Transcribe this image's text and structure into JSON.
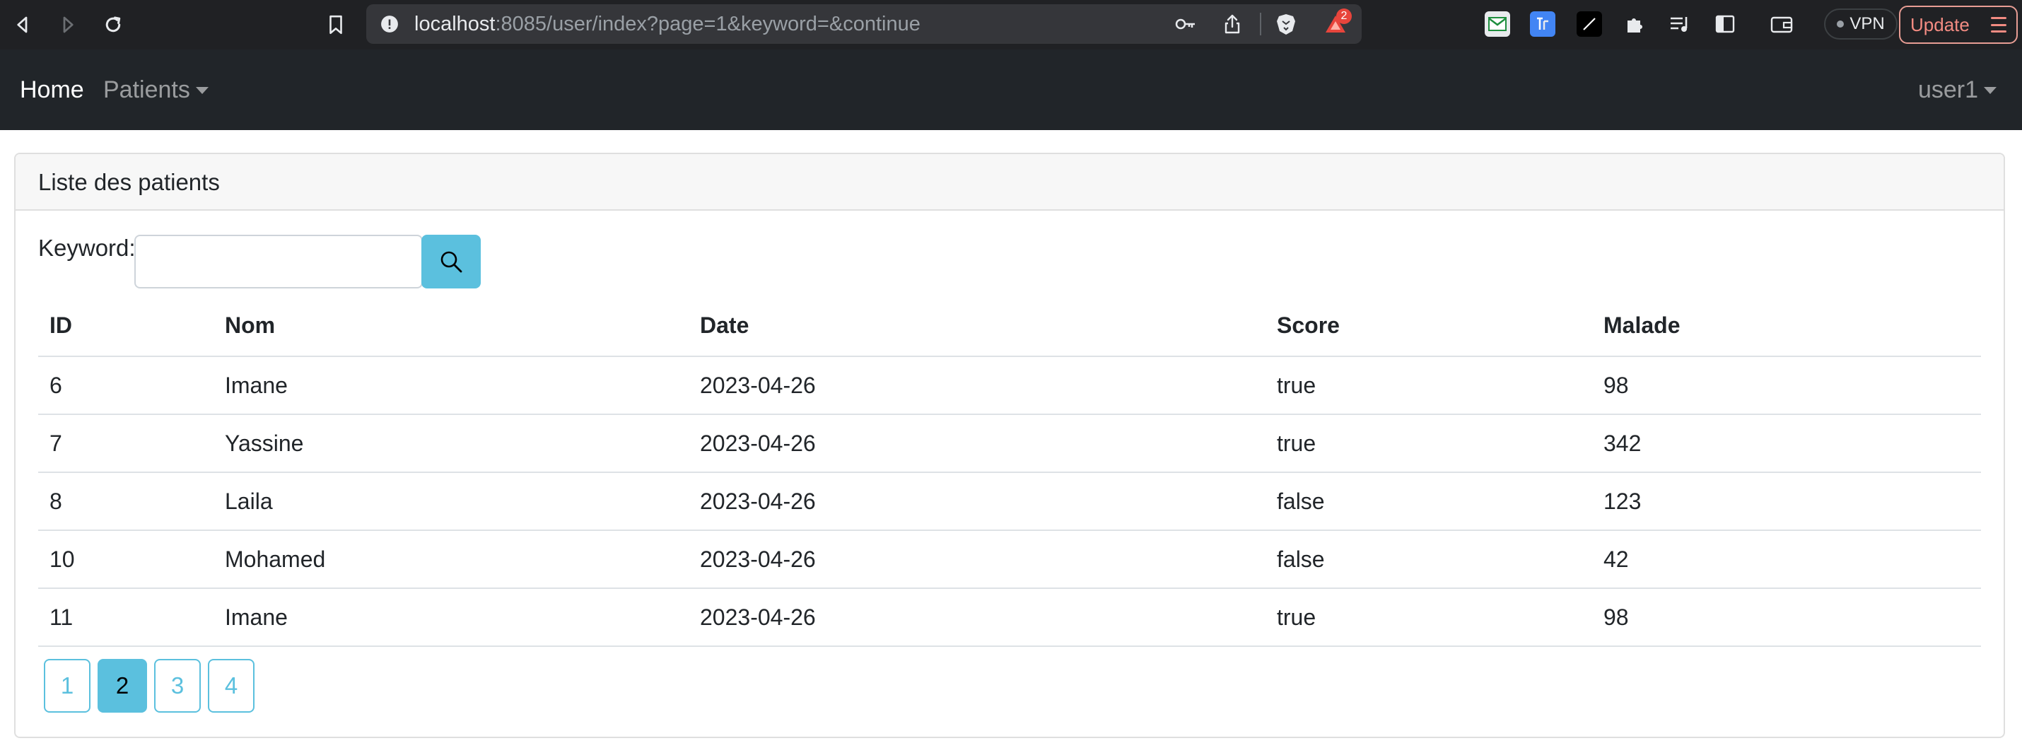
{
  "browser": {
    "url_host": "localhost",
    "url_rest": ":8085/user/index?page=1&keyword=&continue",
    "brave_rewards_badge": "2",
    "vpn_label": "VPN",
    "update_label": "Update"
  },
  "navbar": {
    "home_label": "Home",
    "patients_label": "Patients",
    "user_label": "user1"
  },
  "card": {
    "title": "Liste des patients",
    "keyword_label": "Keyword:",
    "keyword_value": ""
  },
  "table": {
    "headers": [
      "ID",
      "Nom",
      "Date",
      "Score",
      "Malade"
    ],
    "rows": [
      [
        "6",
        "Imane",
        "2023-04-26",
        "true",
        "98"
      ],
      [
        "7",
        "Yassine",
        "2023-04-26",
        "true",
        "342"
      ],
      [
        "8",
        "Laila",
        "2023-04-26",
        "false",
        "123"
      ],
      [
        "10",
        "Mohamed",
        "2023-04-26",
        "false",
        "42"
      ],
      [
        "11",
        "Imane",
        "2023-04-26",
        "true",
        "98"
      ]
    ]
  },
  "pagination": {
    "pages": [
      "1",
      "2",
      "3",
      "4"
    ],
    "active_page": "2"
  },
  "colors": {
    "accent": "#5bc0de",
    "navbar_bg": "#212529"
  }
}
